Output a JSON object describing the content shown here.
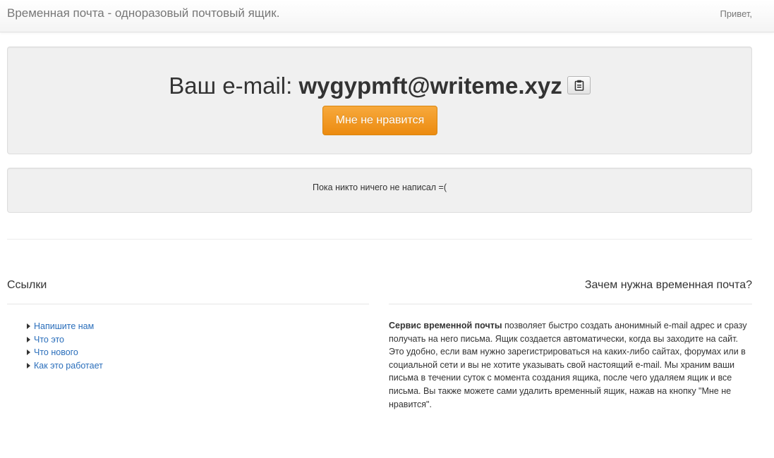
{
  "header": {
    "title": "Временная почта - одноразовый почтовый ящик.",
    "greeting": "Привет,"
  },
  "email_panel": {
    "prefix": "Ваш e-mail: ",
    "address": "wygypmft@writeme.xyz",
    "copy_icon": "clipboard-icon",
    "dislike_label": "Мне не нравится"
  },
  "inbox": {
    "empty_text": "Пока никто ничего не написал =("
  },
  "links_section": {
    "title": "Ссылки",
    "items": [
      {
        "label": "Напишите нам"
      },
      {
        "label": "Что это"
      },
      {
        "label": "Что нового"
      },
      {
        "label": "Как это работает"
      }
    ]
  },
  "about_section": {
    "title": "Зачем нужна временная почта?",
    "bold_lead": "Сервис временной почты",
    "body": " позволяет быстро создать анонимный e-mail адрес и сразу получать на него письма. Ящик создается автоматически, когда вы заходите на сайт. Это удобно, если вам нужно зарегистрироваться на каких-либо сайтах, форумах или в социальной сети и вы не хотите указывать свой настоящий e-mail. Мы храним ваши письма в течении суток с момента создания ящика, после чего удаляем ящик и все письма. Вы также можете сами удалить временный ящик, нажав на кнопку \"Мне не нравится\"."
  },
  "colors": {
    "accent_orange": "#ec8b10",
    "link_blue": "#2a6ebb",
    "well_bg": "#f0f0f0"
  }
}
